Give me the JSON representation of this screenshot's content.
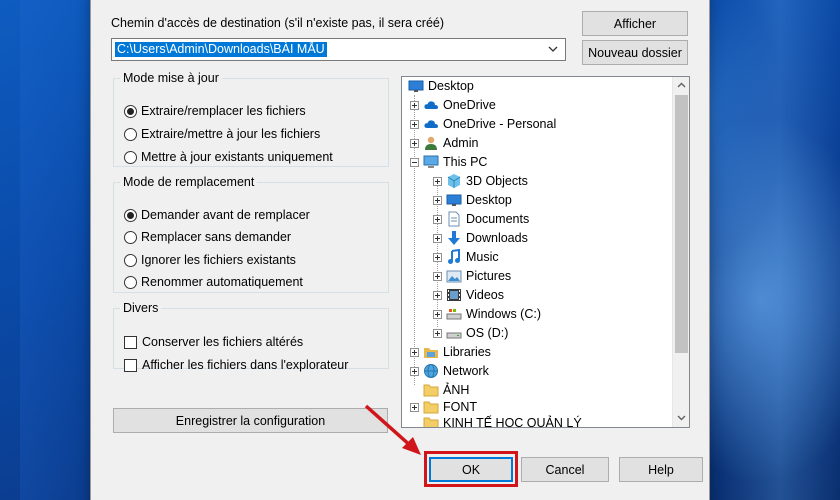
{
  "destination": {
    "label": "Chemin d'accès de destination (s'il n'existe pas, il sera créé)",
    "path": "C:\\Users\\Admin\\Downloads\\BÀI MẪU",
    "show_button": "Afficher",
    "new_folder_button": "Nouveau dossier"
  },
  "update_mode": {
    "legend": "Mode mise à jour",
    "options": [
      {
        "label": "Extraire/remplacer les fichiers",
        "selected": true
      },
      {
        "label": "Extraire/mettre à jour les fichiers",
        "selected": false
      },
      {
        "label": "Mettre à jour existants uniquement",
        "selected": false
      }
    ]
  },
  "overwrite_mode": {
    "legend": "Mode de remplacement",
    "options": [
      {
        "label": "Demander avant de remplacer",
        "selected": true
      },
      {
        "label": "Remplacer sans demander",
        "selected": false
      },
      {
        "label": "Ignorer les fichiers existants",
        "selected": false
      },
      {
        "label": "Renommer automatiquement",
        "selected": false
      }
    ]
  },
  "misc": {
    "legend": "Divers",
    "options": [
      {
        "label": "Conserver les fichiers altérés",
        "checked": false
      },
      {
        "label": "Afficher les fichiers dans l'explorateur",
        "checked": false
      }
    ]
  },
  "save_config_button": "Enregistrer la configuration",
  "tree": {
    "items": [
      {
        "label": "Desktop",
        "icon": "desktop-icon"
      },
      {
        "label": "OneDrive",
        "icon": "cloud-icon"
      },
      {
        "label": "OneDrive - Personal",
        "icon": "cloud-icon"
      },
      {
        "label": "Admin",
        "icon": "user-icon"
      },
      {
        "label": "This PC",
        "icon": "computer-icon"
      },
      {
        "label": "3D Objects",
        "icon": "cube-icon"
      },
      {
        "label": "Desktop",
        "icon": "desktop-icon"
      },
      {
        "label": "Documents",
        "icon": "document-icon"
      },
      {
        "label": "Downloads",
        "icon": "download-icon"
      },
      {
        "label": "Music",
        "icon": "music-icon"
      },
      {
        "label": "Pictures",
        "icon": "picture-icon"
      },
      {
        "label": "Videos",
        "icon": "video-icon"
      },
      {
        "label": "Windows (C:)",
        "icon": "drive-icon"
      },
      {
        "label": "OS (D:)",
        "icon": "drive-icon"
      },
      {
        "label": "Libraries",
        "icon": "library-icon"
      },
      {
        "label": "Network",
        "icon": "network-icon"
      },
      {
        "label": "ẢNH",
        "icon": "folder-icon"
      },
      {
        "label": "FONT",
        "icon": "folder-icon"
      },
      {
        "label": "KINH TẾ HỌC QUẢN LÝ",
        "icon": "folder-icon"
      }
    ]
  },
  "footer": {
    "ok": "OK",
    "cancel": "Cancel",
    "help": "Help"
  },
  "colors": {
    "highlight": "#d0161b",
    "selection": "#0078d7"
  }
}
